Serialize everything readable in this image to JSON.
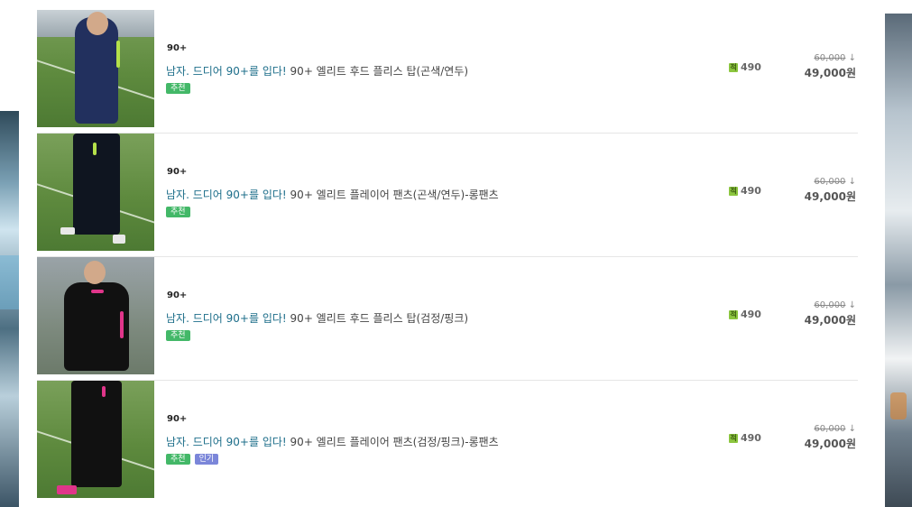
{
  "products": [
    {
      "brand": "90+",
      "promo": "남자. 드디어 90+를 입다!",
      "name": "90+ 엘리트 후드 플리스 탑(곤색/연두)",
      "badges": [
        "추천"
      ],
      "points_icon": "적",
      "points": "490",
      "original_price": "60,000",
      "arrow": "↓",
      "price": "49,000원",
      "image": "model-navy-hoodie"
    },
    {
      "brand": "90+",
      "promo": "남자. 드디어 90+를 입다!",
      "name": "90+ 엘리트 플레이어 팬츠(곤색/연두)-롱팬츠",
      "badges": [
        "추천"
      ],
      "points_icon": "적",
      "points": "490",
      "original_price": "60,000",
      "arrow": "↓",
      "price": "49,000원",
      "image": "model-navy-pants"
    },
    {
      "brand": "90+",
      "promo": "남자. 드디어 90+를 입다!",
      "name": "90+ 엘리트 후드 플리스 탑(검정/핑크)",
      "badges": [
        "추천"
      ],
      "points_icon": "적",
      "points": "490",
      "original_price": "60,000",
      "arrow": "↓",
      "price": "49,000원",
      "image": "model-black-hoodie"
    },
    {
      "brand": "90+",
      "promo": "남자. 드디어 90+를 입다!",
      "name": "90+ 엘리트 플레이어 팬츠(검정/핑크)-롱팬츠",
      "badges": [
        "추천",
        "인기"
      ],
      "points_icon": "적",
      "points": "490",
      "original_price": "60,000",
      "arrow": "↓",
      "price": "49,000원",
      "image": "model-black-pants"
    }
  ],
  "colors": {
    "promo_text": "#1d6e8a",
    "badge_recommend": "#43b868",
    "badge_popular": "#7b86d9",
    "points_icon": "#8cc63f"
  }
}
